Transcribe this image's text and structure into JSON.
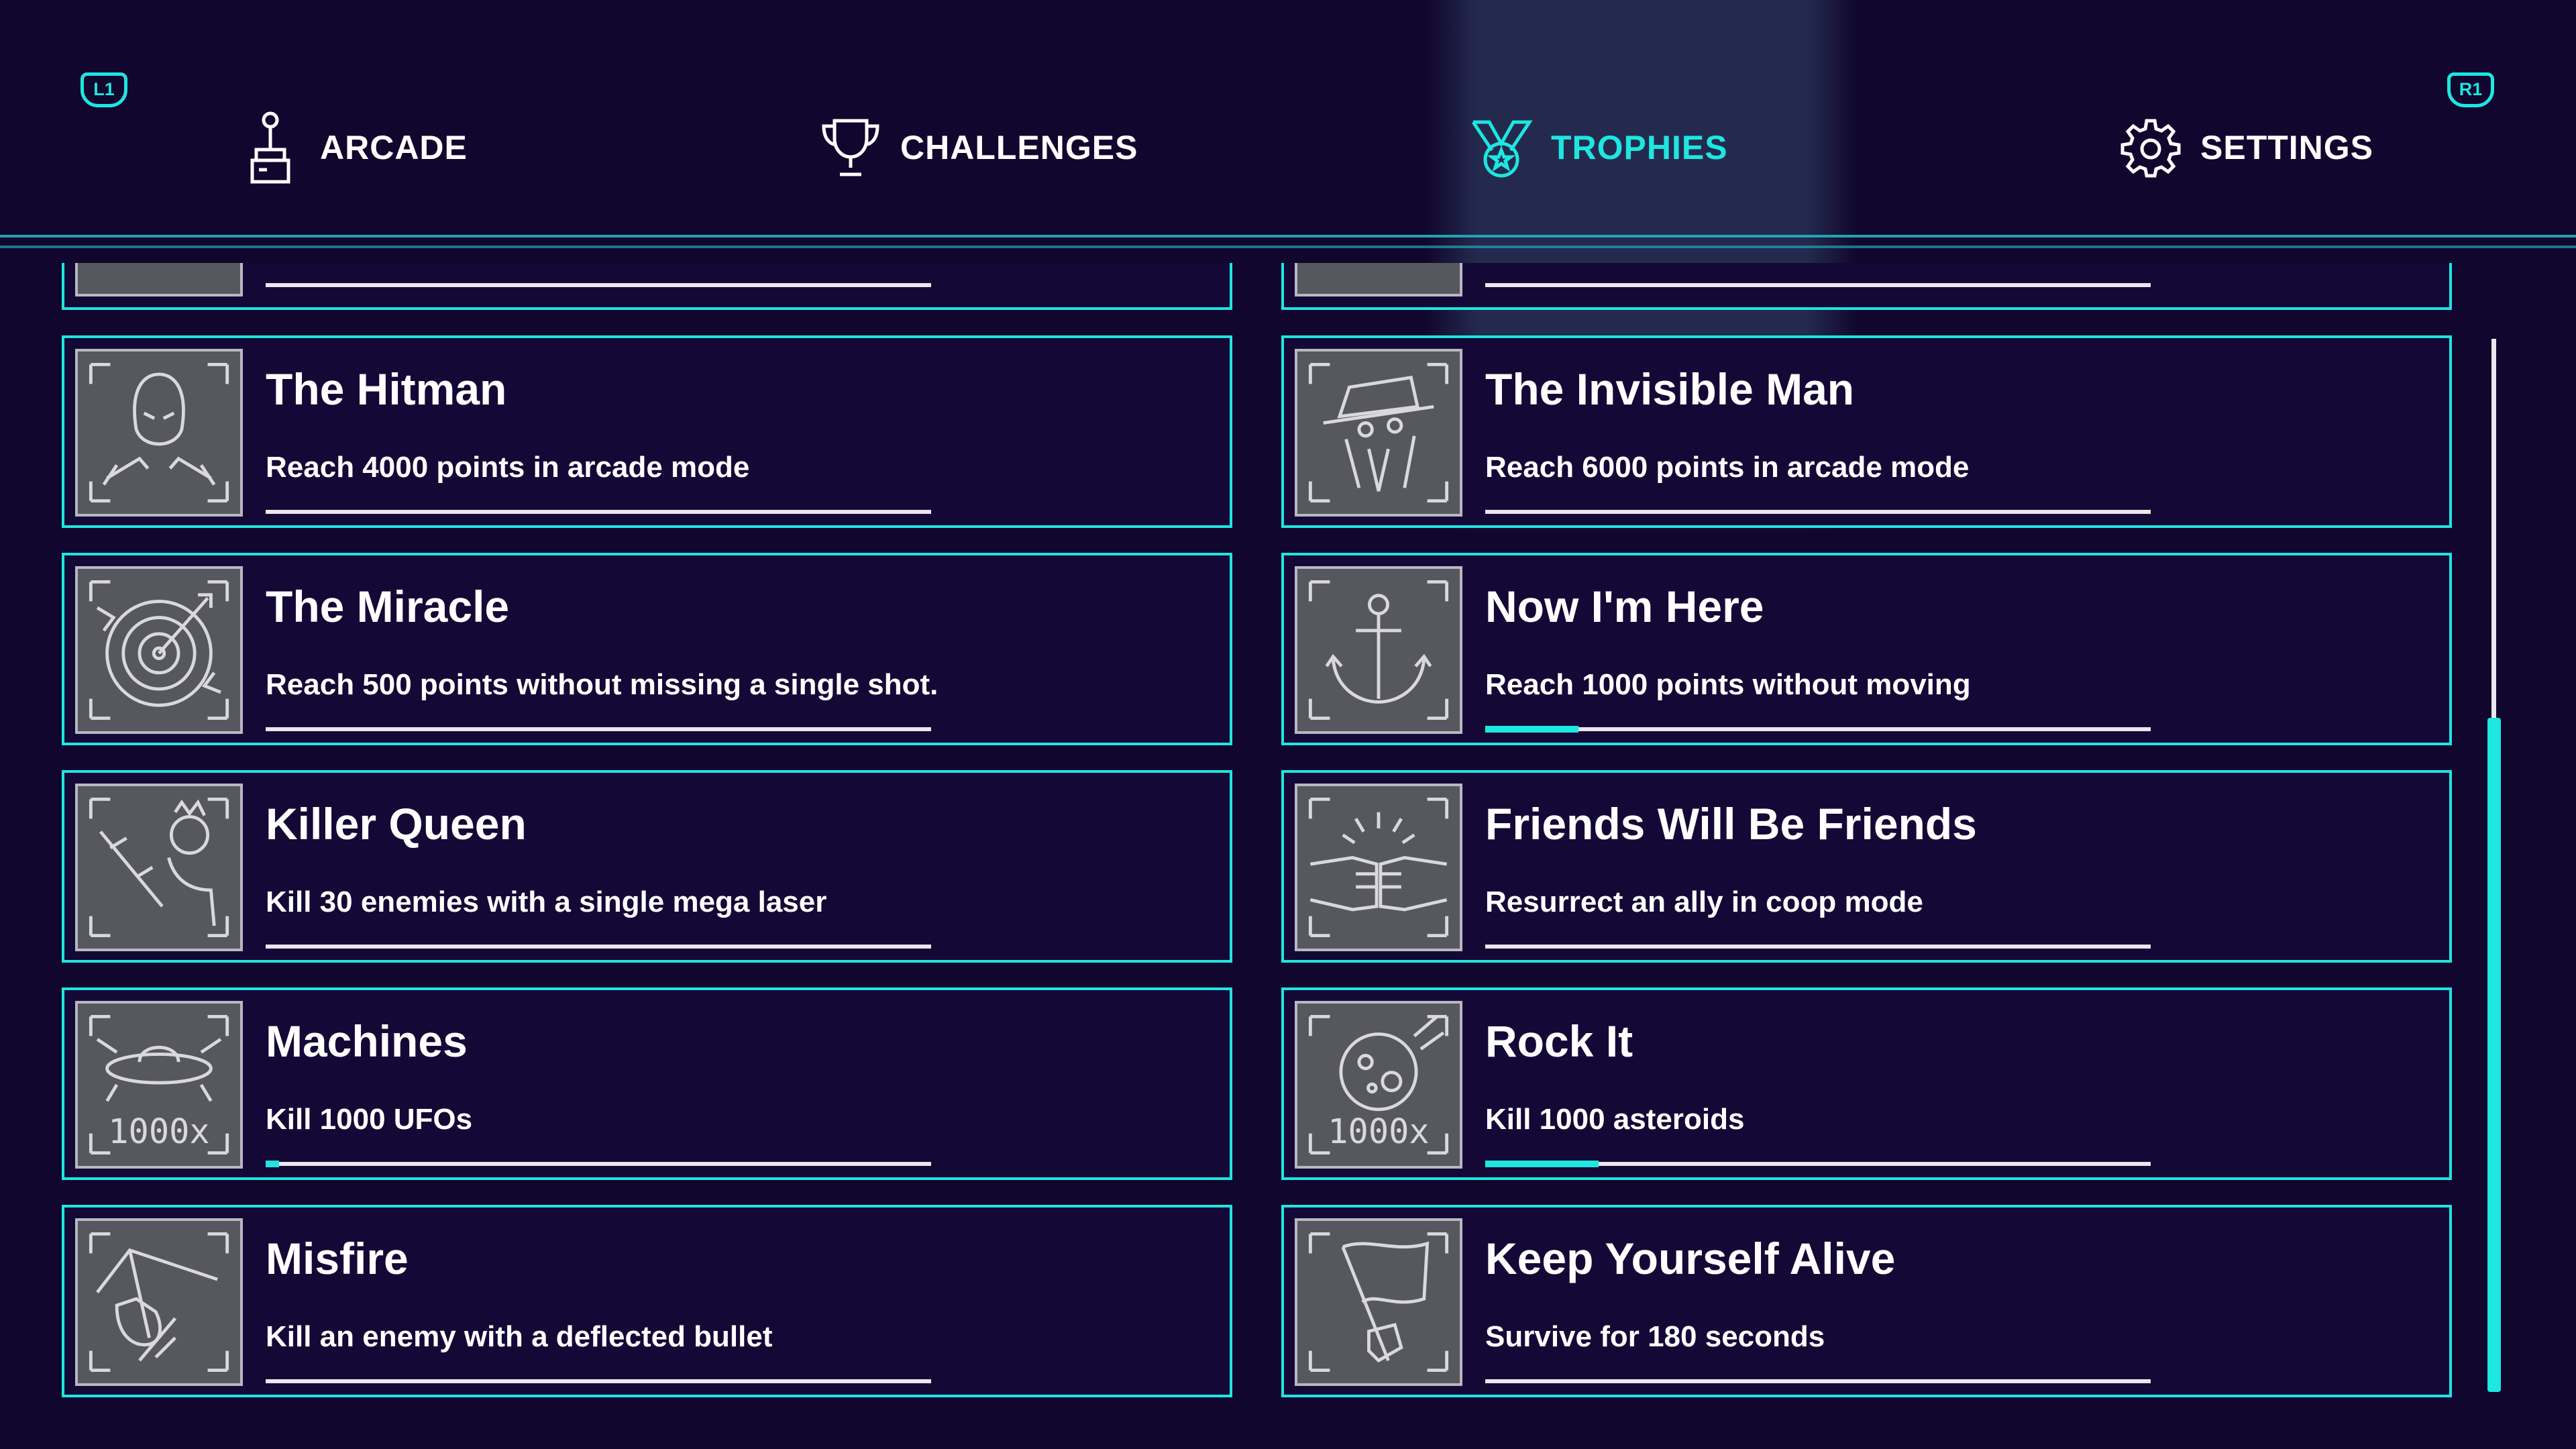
{
  "colors": {
    "background": "#11062d",
    "accent": "#1ee6e0",
    "card_bg": "#140936",
    "icon_bg": "#57575f"
  },
  "header": {
    "left_shoulder": "L1",
    "right_shoulder": "R1",
    "tabs": [
      {
        "label": "ARCADE",
        "icon": "joystick-icon",
        "active": false
      },
      {
        "label": "CHALLENGES",
        "icon": "trophy-cup-icon",
        "active": false
      },
      {
        "label": "TROPHIES",
        "icon": "medal-icon",
        "active": true
      },
      {
        "label": "SETTINGS",
        "icon": "gear-icon",
        "active": false
      }
    ]
  },
  "trophies": [
    {
      "title": "The Hitman",
      "description": "Reach 4000 points in arcade mode",
      "icon": "hitman-icon",
      "progress": 0
    },
    {
      "title": "The Invisible Man",
      "description": "Reach 6000 points in arcade mode",
      "icon": "invisible-man-icon",
      "progress": 0
    },
    {
      "title": "The Miracle",
      "description": "Reach 500 points without missing a single shot.",
      "icon": "target-icon",
      "progress": 0
    },
    {
      "title": "Now I'm Here",
      "description": "Reach 1000 points without moving",
      "icon": "anchor-icon",
      "progress": 0.14
    },
    {
      "title": "Killer Queen",
      "description": "Kill 30 enemies with a single mega laser",
      "icon": "queen-gun-icon",
      "progress": 0
    },
    {
      "title": "Friends Will Be Friends",
      "description": "Resurrect an ally in coop mode",
      "icon": "fist-bump-icon",
      "progress": 0
    },
    {
      "title": "Machines",
      "description": "Kill 1000 UFOs",
      "icon": "ufo-icon",
      "icon_text": "1000x",
      "progress": 0.02
    },
    {
      "title": "Rock It",
      "description": "Kill 1000 asteroids",
      "icon": "asteroid-icon",
      "icon_text": "1000x",
      "progress": 0.17
    },
    {
      "title": "Misfire",
      "description": "Kill an enemy with a deflected bullet",
      "icon": "deflect-icon",
      "progress": 0
    },
    {
      "title": "Keep Yourself Alive",
      "description": "Survive for 180 seconds",
      "icon": "flag-icon",
      "progress": 0
    }
  ],
  "scrollbar": {
    "position": 0.64
  }
}
